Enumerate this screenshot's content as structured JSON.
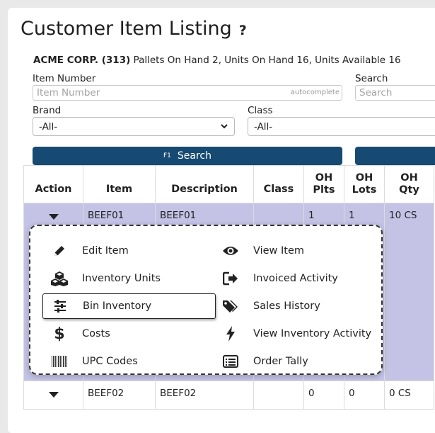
{
  "page": {
    "title": "Customer Item Listing",
    "help": "?"
  },
  "summary": {
    "customer": "ACME CORP. (313)",
    "pallets": " Pallets On Hand 2,",
    "units": " Units On Hand 16,",
    "available": " Units Available 16"
  },
  "filters": {
    "item_number_label": "Item Number",
    "item_number_placeholder": "Item Number",
    "autocomplete_tag": "autocomplete",
    "search_label": "Search",
    "search_placeholder": "Search",
    "brand_label": "Brand",
    "brand_value": "-All-",
    "class_label": "Class",
    "class_value": "-All-"
  },
  "buttons": {
    "search_key": "F1",
    "search": "Search"
  },
  "table": {
    "headers": [
      "Action",
      "Item",
      "Description",
      "Class",
      "OH Plts",
      "OH Lots",
      "OH Qty"
    ],
    "rows": [
      {
        "item": "BEEF01",
        "description": "BEEF01",
        "class": "",
        "oh_plts": "1",
        "oh_lots": "1",
        "oh_qty": "10 CS"
      },
      {
        "item": "BEEF02",
        "description": "BEEF02",
        "class": "",
        "oh_plts": "0",
        "oh_lots": "0",
        "oh_qty": "0 CS"
      }
    ]
  },
  "menu": {
    "left": [
      "Edit Item",
      "Inventory Units",
      "Bin Inventory",
      "Costs",
      "UPC Codes"
    ],
    "right": [
      "View Item",
      "Invoiced Activity",
      "Sales History",
      "View Inventory Activity",
      "Order Tally"
    ]
  },
  "colors": {
    "primary_button": "#164a72",
    "selected_row": "#c4c3e6"
  }
}
